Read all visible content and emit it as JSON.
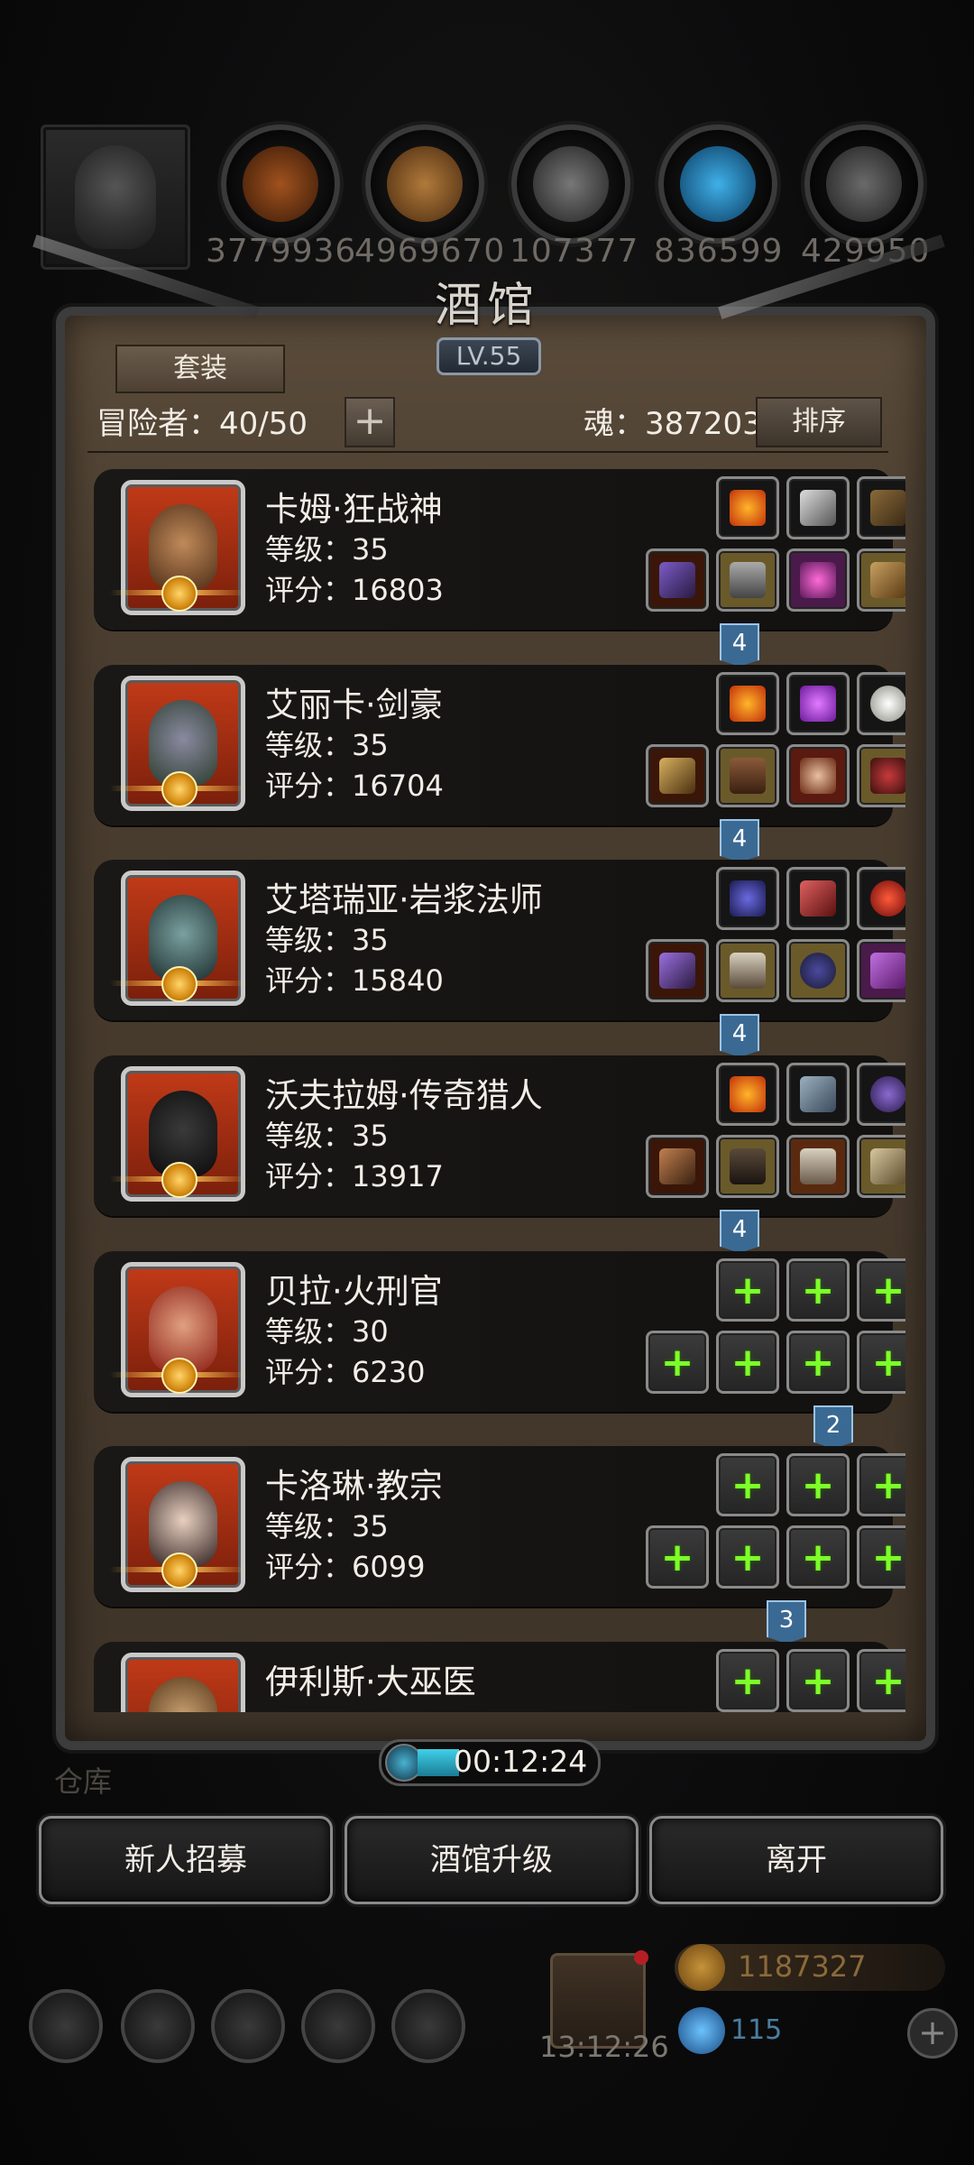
{
  "resources": {
    "values": [
      "3779936",
      "4969670",
      "107377",
      "836599",
      "429950"
    ],
    "icons": [
      "bread-icon",
      "wood-icon",
      "iron-icon",
      "crystal-icon",
      "stone-icon"
    ]
  },
  "panel": {
    "title": "酒馆",
    "level": "LV.55",
    "suit_button": "套装",
    "adventurers": "冒险者：40/50",
    "soul": "魂：387203",
    "sort_button": "排序"
  },
  "heroes": [
    {
      "name": "卡姆·狂战神",
      "level": "等级：35",
      "score": "评分：16803",
      "badge": "4",
      "equipped": true
    },
    {
      "name": "艾丽卡·剑豪",
      "level": "等级：35",
      "score": "评分：16704",
      "badge": "4",
      "equipped": true
    },
    {
      "name": "艾塔瑞亚·岩浆法师",
      "level": "等级：35",
      "score": "评分：15840",
      "badge": "4",
      "equipped": true
    },
    {
      "name": "沃夫拉姆·传奇猎人",
      "level": "等级：35",
      "score": "评分：13917",
      "badge": "4",
      "equipped": true
    },
    {
      "name": "贝拉·火刑官",
      "level": "等级：30",
      "score": "评分：6230",
      "badge": "2",
      "equipped": false
    },
    {
      "name": "卡洛琳·教宗",
      "level": "等级：35",
      "score": "评分：6099",
      "badge": "3",
      "equipped": false
    },
    {
      "name": "伊利斯·大巫医",
      "level": "",
      "score": "",
      "badge": "",
      "equipped": false
    }
  ],
  "timer": "00:12:24",
  "buttons": {
    "recruit": "新人招募",
    "upgrade": "酒馆升级",
    "leave": "离开"
  },
  "bottom": {
    "warehouse": "仓库",
    "gift_timer": "13:12:26",
    "gold": "1187327",
    "gems": "115"
  },
  "colors": {
    "accent_green": "#7dff2a",
    "badge_blue": "#3a6a93",
    "panel_brown": "#4b3e30"
  }
}
